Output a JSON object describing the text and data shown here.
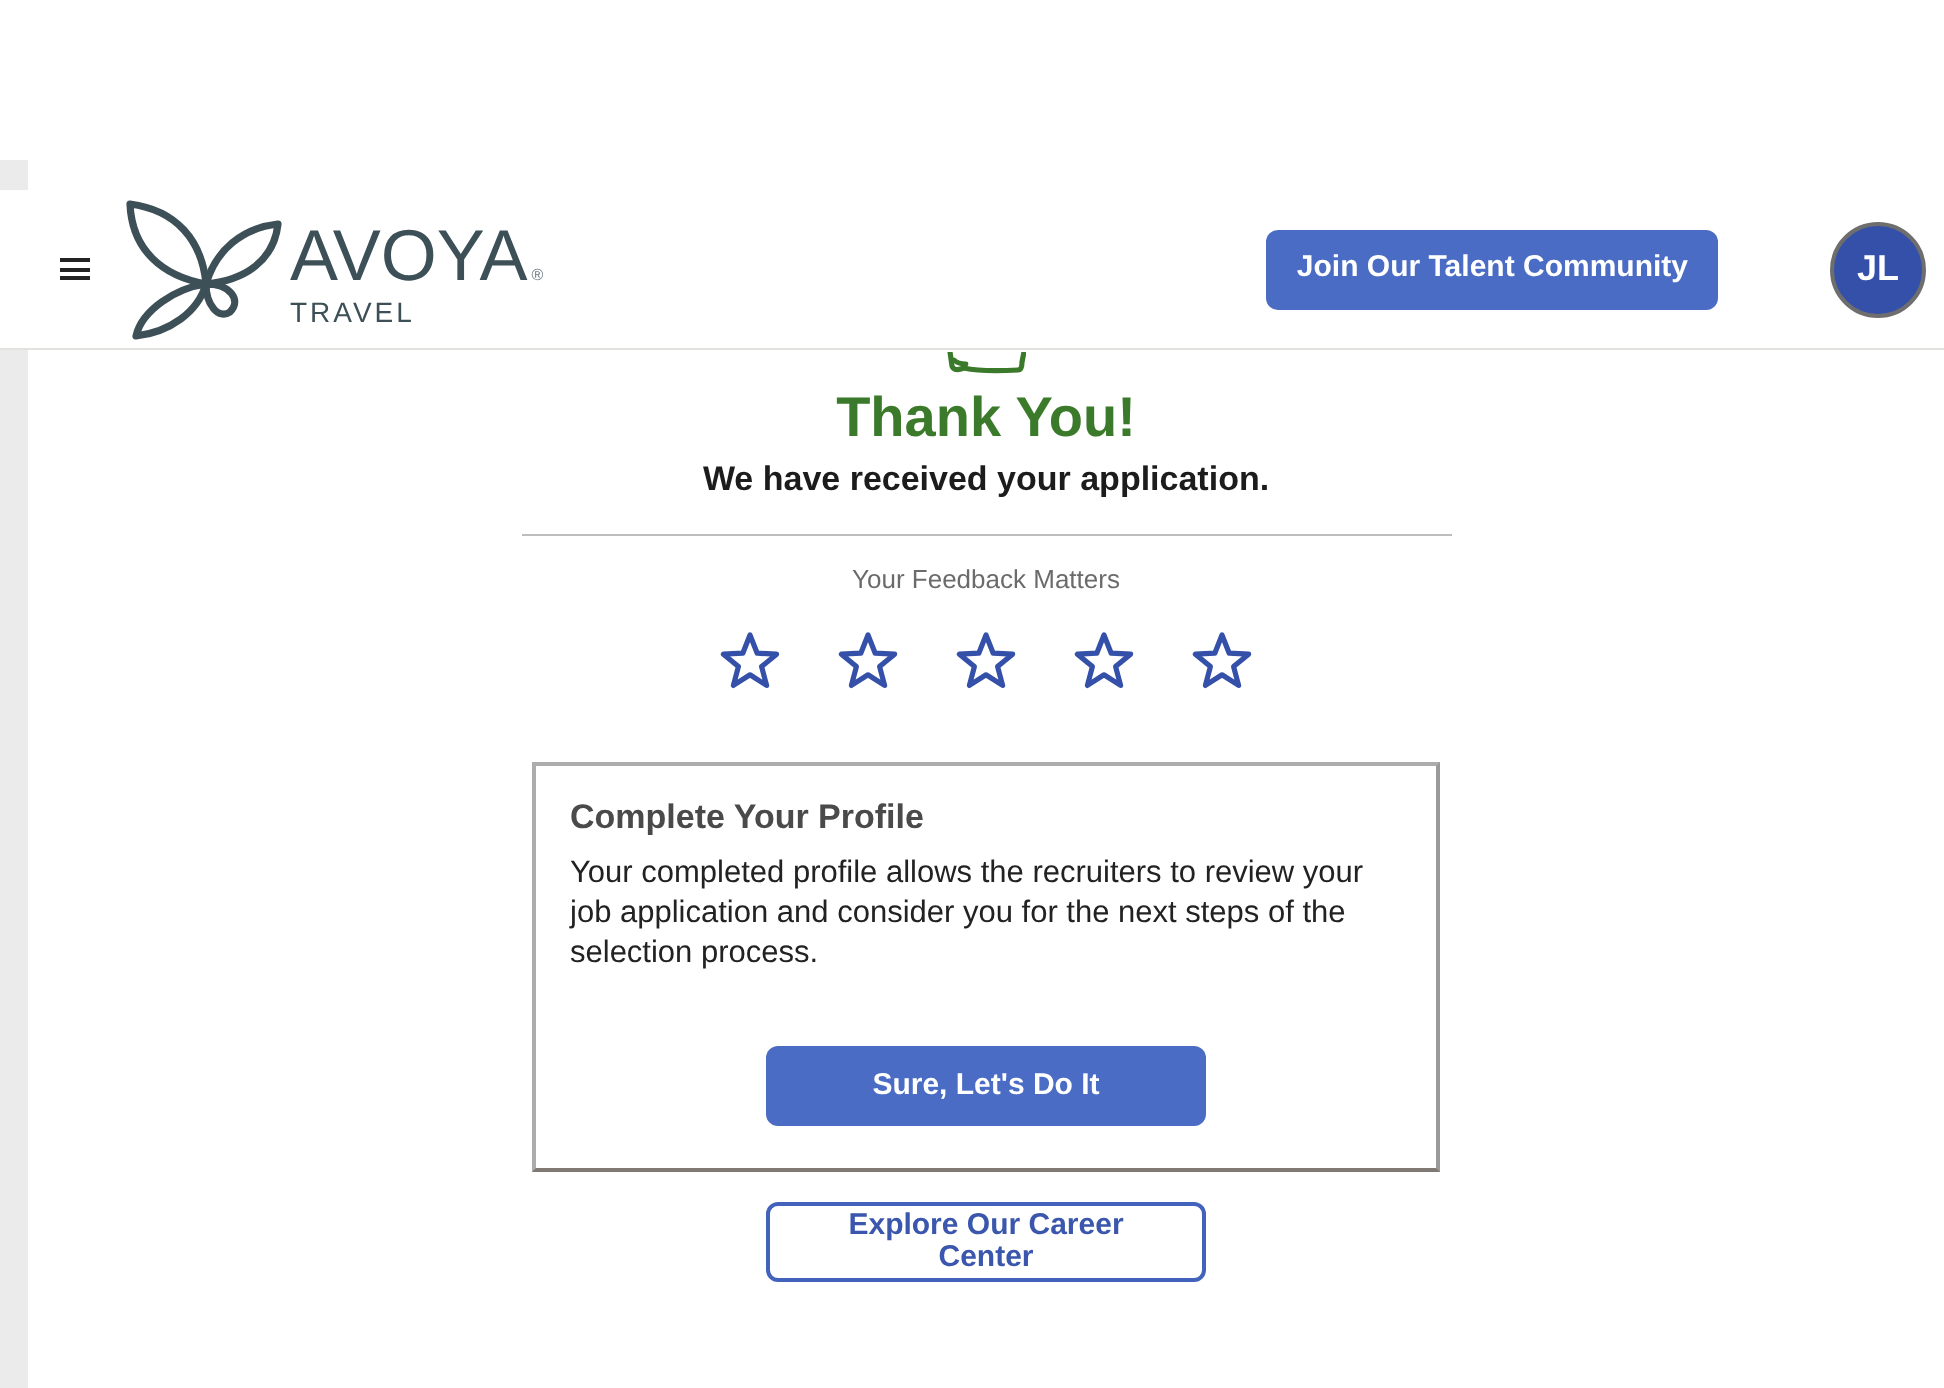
{
  "header": {
    "logo": {
      "name": "AVOYA",
      "mark": "®",
      "sub": "TRAVEL"
    },
    "join_button": "Join Our Talent Community",
    "avatar": "JL"
  },
  "confirmation": {
    "title": "Thank You!",
    "message": "We have received your application."
  },
  "feedback": {
    "label": "Your Feedback Matters",
    "stars": 0
  },
  "profile_card": {
    "title": "Complete Your Profile",
    "body": "Your completed profile allows the recruiters to review your job application and consider you for the next steps of the selection process.",
    "button": "Sure, Let's Do It"
  },
  "career_button": "Explore Our Career Center"
}
